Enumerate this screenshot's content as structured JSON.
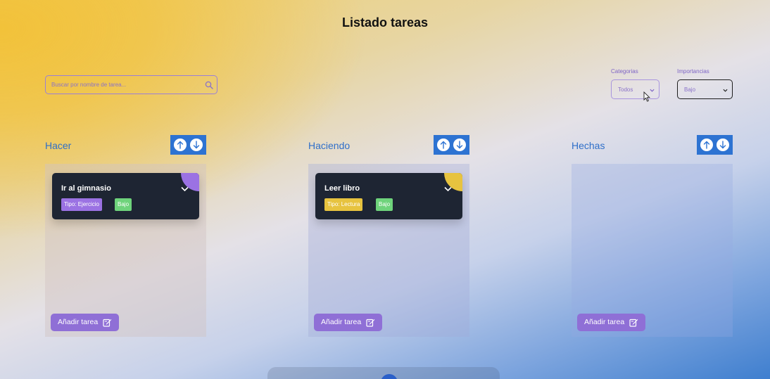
{
  "page": {
    "title": "Listado tareas"
  },
  "search": {
    "placeholder": "Buscar por nombre de tarea..."
  },
  "filters": {
    "categories": {
      "label": "Categorias",
      "selected": "Todos"
    },
    "importance": {
      "label": "Importancias",
      "selected": "Bajo"
    }
  },
  "columns": [
    {
      "title": "Hacer",
      "add_label": "Añadir tarea",
      "cards": [
        {
          "name": "Ir al gimnasio",
          "type": "Tipo: Ejercicio",
          "level": "Bajo",
          "accent": "#9b72e3"
        }
      ]
    },
    {
      "title": "Haciendo",
      "add_label": "Añadir tarea",
      "cards": [
        {
          "name": "Leer libro",
          "type": "Tipo: Lectura",
          "level": "Bajo",
          "accent": "#e7c33f"
        }
      ]
    },
    {
      "title": "Hechas",
      "add_label": "Añadir tarea",
      "cards": []
    }
  ],
  "colors": {
    "accent_purple": "#8f6fd6",
    "sort_blue": "#2d73d2",
    "level_green": "#6ed37b",
    "card_dark": "#1e2533"
  }
}
